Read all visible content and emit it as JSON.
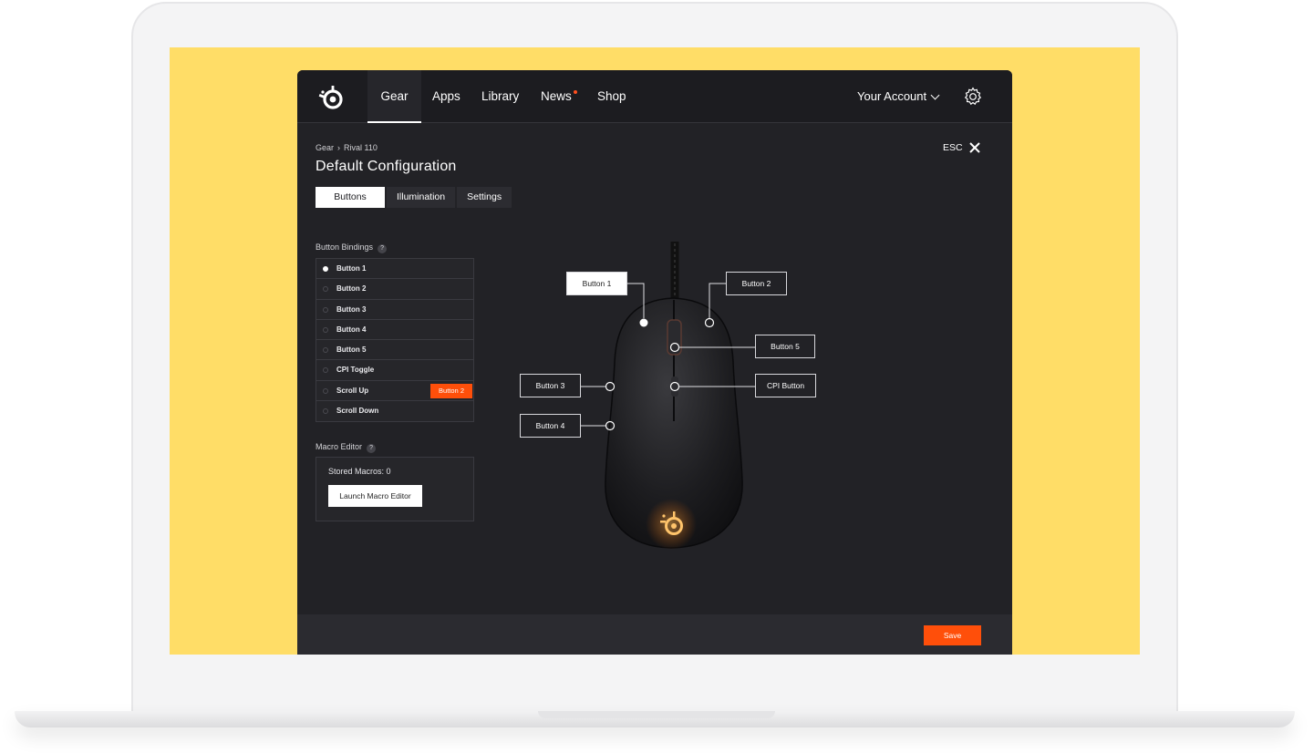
{
  "nav": {
    "items": [
      {
        "label": "Gear"
      },
      {
        "label": "Apps"
      },
      {
        "label": "Library"
      },
      {
        "label": "News"
      },
      {
        "label": "Shop"
      }
    ],
    "account_label": "Your Account"
  },
  "breadcrumb": {
    "root": "Gear",
    "separator": "›",
    "current": "Rival 110"
  },
  "page_title": "Default Configuration",
  "esc_label": "ESC",
  "tabs": [
    {
      "label": "Buttons"
    },
    {
      "label": "Illumination"
    },
    {
      "label": "Settings"
    }
  ],
  "bindings": {
    "label": "Button Bindings",
    "help": "?",
    "rows": [
      {
        "label": "Button 1",
        "selected": true
      },
      {
        "label": "Button 2"
      },
      {
        "label": "Button 3"
      },
      {
        "label": "Button 4"
      },
      {
        "label": "Button 5"
      },
      {
        "label": "CPI Toggle"
      },
      {
        "label": "Scroll Up",
        "tag": "Button 2"
      },
      {
        "label": "Scroll Down"
      }
    ]
  },
  "macro": {
    "label": "Macro Editor",
    "help": "?",
    "stored": "Stored Macros: 0",
    "button": "Launch Macro Editor"
  },
  "callouts": {
    "b1": "Button 1",
    "b2": "Button 2",
    "b3": "Button 3",
    "b4": "Button 4",
    "b5": "Button 5",
    "cpi": "CPI Button"
  },
  "save_label": "Save",
  "colors": {
    "accent": "#ff4f0a",
    "background": "#ffdd67",
    "panel": "#222226"
  }
}
